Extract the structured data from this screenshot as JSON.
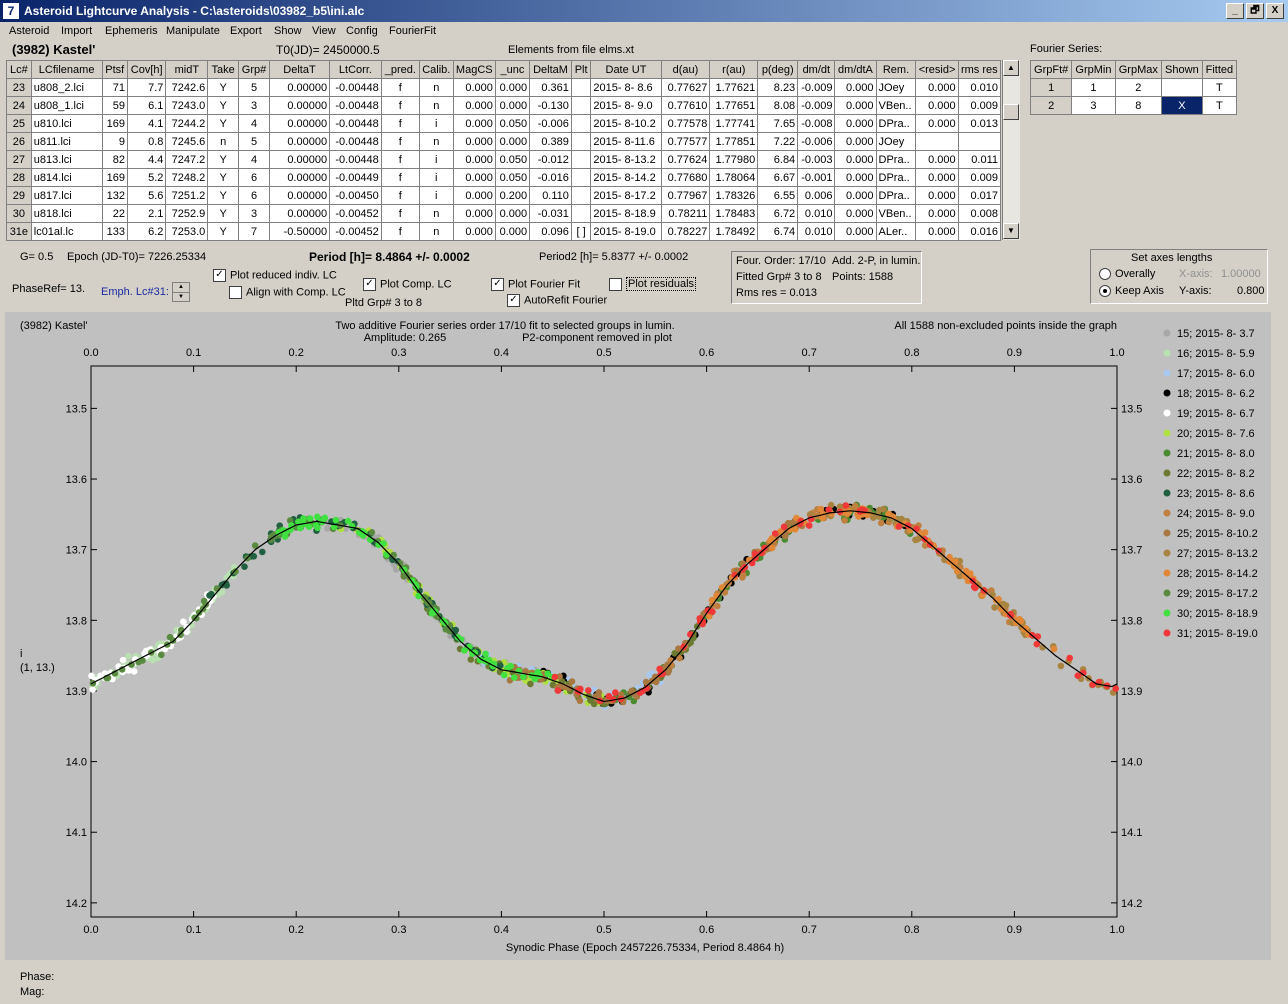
{
  "window": {
    "title": "Asteroid Lightcurve Analysis - C:\\asteroids\\03982_b5\\ini.alc",
    "icon_text": "7"
  },
  "window_buttons": [
    "_",
    "🗗",
    "X"
  ],
  "menu": [
    "Asteroid",
    "Import",
    "Ephemeris",
    "Manipulate",
    "Export",
    "Show",
    "View",
    "Config",
    "FourierFit"
  ],
  "header": {
    "object": "(3982) Kastel'",
    "t0": "T0(JD)= 2450000.5",
    "elements": "Elements from file elms.xt",
    "fourier_series_label": "Fourier Series:"
  },
  "lc_table": {
    "columns": [
      "Lc#",
      "LCfilename",
      "Ptsf",
      "Cov[h]",
      "midT",
      "Take",
      "Grp#",
      "DeltaT",
      "LtCorr.",
      "_pred.",
      "Calib.",
      "MagCS",
      "_unc",
      "DeltaM",
      "Plt",
      "Date UT",
      "d(au)",
      "r(au)",
      "p(deg)",
      "dm/dt",
      "dm/dtA",
      "Rem.",
      "<resid>",
      "rms res"
    ],
    "rows": [
      [
        "23",
        "u808_2.lci",
        "71",
        "7.7",
        "7242.6",
        "Y",
        "5",
        "0.00000",
        "-0.00448",
        "f",
        "n",
        "0.000",
        "0.000",
        "0.361",
        "",
        "2015- 8- 8.6",
        "0.77627",
        "1.77621",
        "8.23",
        "-0.009",
        "0.000",
        "JOey",
        "0.000",
        "0.010"
      ],
      [
        "24",
        "u808_1.lci",
        "59",
        "6.1",
        "7243.0",
        "Y",
        "3",
        "0.00000",
        "-0.00448",
        "f",
        "n",
        "0.000",
        "0.000",
        "-0.130",
        "",
        "2015- 8- 9.0",
        "0.77610",
        "1.77651",
        "8.08",
        "-0.009",
        "0.000",
        "VBen..",
        "0.000",
        "0.009"
      ],
      [
        "25",
        "u810.lci",
        "169",
        "4.1",
        "7244.2",
        "Y",
        "4",
        "0.00000",
        "-0.00448",
        "f",
        "i",
        "0.000",
        "0.050",
        "-0.006",
        "",
        "2015- 8-10.2",
        "0.77578",
        "1.77741",
        "7.65",
        "-0.008",
        "0.000",
        "DPra..",
        "0.000",
        "0.013"
      ],
      [
        "26",
        "u811.lci",
        "9",
        "0.8",
        "7245.6",
        "n",
        "5",
        "0.00000",
        "-0.00448",
        "f",
        "n",
        "0.000",
        "0.000",
        "0.389",
        "",
        "2015- 8-11.6",
        "0.77577",
        "1.77851",
        "7.22",
        "-0.006",
        "0.000",
        "JOey",
        "",
        ""
      ],
      [
        "27",
        "u813.lci",
        "82",
        "4.4",
        "7247.2",
        "Y",
        "4",
        "0.00000",
        "-0.00448",
        "f",
        "i",
        "0.000",
        "0.050",
        "-0.012",
        "",
        "2015- 8-13.2",
        "0.77624",
        "1.77980",
        "6.84",
        "-0.003",
        "0.000",
        "DPra..",
        "0.000",
        "0.011"
      ],
      [
        "28",
        "u814.lci",
        "169",
        "5.2",
        "7248.2",
        "Y",
        "6",
        "0.00000",
        "-0.00449",
        "f",
        "i",
        "0.000",
        "0.050",
        "-0.016",
        "",
        "2015- 8-14.2",
        "0.77680",
        "1.78064",
        "6.67",
        "-0.001",
        "0.000",
        "DPra..",
        "0.000",
        "0.009"
      ],
      [
        "29",
        "u817.lci",
        "132",
        "5.6",
        "7251.2",
        "Y",
        "6",
        "0.00000",
        "-0.00450",
        "f",
        "i",
        "0.000",
        "0.200",
        "0.110",
        "",
        "2015- 8-17.2",
        "0.77967",
        "1.78326",
        "6.55",
        "0.006",
        "0.000",
        "DPra..",
        "0.000",
        "0.017"
      ],
      [
        "30",
        "u818.lci",
        "22",
        "2.1",
        "7252.9",
        "Y",
        "3",
        "0.00000",
        "-0.00452",
        "f",
        "n",
        "0.000",
        "0.000",
        "-0.031",
        "",
        "2015- 8-18.9",
        "0.78211",
        "1.78483",
        "6.72",
        "0.010",
        "0.000",
        "VBen..",
        "0.000",
        "0.008"
      ],
      [
        "31e",
        "lc01al.lc",
        "133",
        "6.2",
        "7253.0",
        "Y",
        "7",
        "-0.50000",
        "-0.00452",
        "f",
        "n",
        "0.000",
        "0.000",
        "0.096",
        "[ ]",
        "2015- 8-19.0",
        "0.78227",
        "1.78492",
        "6.74",
        "0.010",
        "0.000",
        "ALer..",
        "0.000",
        "0.016"
      ]
    ]
  },
  "fourier_table": {
    "columns": [
      "GrpFt#",
      "GrpMin",
      "GrpMax",
      "Shown",
      "Fitted"
    ],
    "rows": [
      [
        "1",
        "1",
        "2",
        "",
        "T"
      ],
      [
        "2",
        "3",
        "8",
        "X",
        "T"
      ]
    ]
  },
  "controls": {
    "g": "G= 0.5",
    "epoch": "Epoch (JD-T0)= 7226.25334",
    "period": "Period [h]= 8.4864 +/- 0.0002",
    "period2": "Period2 [h]= 5.8377 +/- 0.0002",
    "phaseref": "PhaseRef= 13.",
    "emph": "Emph. Lc#31:",
    "plot_reduced": "Plot reduced indiv. LC",
    "align_comp": "Align with Comp. LC",
    "plot_comp": "Plot Comp. LC",
    "pltd_grp": "Pltd Grp#  3   to   8",
    "plot_fourier": "Plot Fourier Fit",
    "autorefit": "AutoRefit Fourier",
    "plot_residuals": "Plot residuals",
    "checked_mark": "✓",
    "four_order": "Four. Order: 17/10",
    "add_2p": "Add. 2-P, in lumin.",
    "fitted_grp": "Fitted Grp# 3 to 8",
    "points": "Points: 1588",
    "rms_res": "Rms res      = 0.013",
    "axes_title": "Set axes lengths",
    "overally": "Overally",
    "keep_axis": "Keep Axis",
    "xaxis_label": "X-axis:",
    "xaxis_val": "1.00000",
    "yaxis_label": "Y-axis:",
    "yaxis_val": "0.800"
  },
  "status": {
    "phase": "Phase:",
    "mag": "Mag:"
  },
  "chart_data": {
    "type": "scatter",
    "title": "(3982) Kastel'",
    "subtitle": "Two additive Fourier series order 17/10 fit to selected groups in lumin.",
    "amplitude": "Amplitude: 0.265",
    "p2_note": "P2-component removed in plot",
    "points_note": "All 1588 non-excluded points inside the graph",
    "xlabel": "Synodic Phase (Epoch 2457226.75334, Period 8.4864 h)",
    "ylabel": "i",
    "ylabel2": "(1, 13.)",
    "xlim": [
      0.0,
      1.0
    ],
    "ylim": [
      14.22,
      13.44
    ],
    "y_inverted": true,
    "xticks": [
      "0.0",
      "0.1",
      "0.2",
      "0.3",
      "0.4",
      "0.5",
      "0.6",
      "0.7",
      "0.8",
      "0.9",
      "1.0"
    ],
    "yticks": [
      "13.5",
      "13.6",
      "13.7",
      "13.8",
      "13.9",
      "14.0",
      "14.1",
      "14.2"
    ],
    "background": "#c0c0c0",
    "legend_position": "right",
    "fit_curve": {
      "x": [
        0.0,
        0.02,
        0.04,
        0.06,
        0.08,
        0.1,
        0.12,
        0.14,
        0.16,
        0.18,
        0.2,
        0.22,
        0.24,
        0.26,
        0.28,
        0.3,
        0.32,
        0.34,
        0.36,
        0.38,
        0.4,
        0.42,
        0.44,
        0.46,
        0.48,
        0.5,
        0.52,
        0.54,
        0.56,
        0.58,
        0.6,
        0.62,
        0.64,
        0.66,
        0.68,
        0.7,
        0.72,
        0.74,
        0.76,
        0.78,
        0.8,
        0.82,
        0.84,
        0.86,
        0.88,
        0.9,
        0.92,
        0.94,
        0.96,
        0.98,
        1.0
      ],
      "y": [
        13.89,
        13.875,
        13.86,
        13.845,
        13.83,
        13.8,
        13.765,
        13.73,
        13.7,
        13.68,
        13.665,
        13.66,
        13.665,
        13.67,
        13.69,
        13.72,
        13.76,
        13.795,
        13.83,
        13.855,
        13.87,
        13.875,
        13.88,
        13.89,
        13.905,
        13.915,
        13.91,
        13.895,
        13.87,
        13.835,
        13.79,
        13.75,
        13.72,
        13.695,
        13.67,
        13.655,
        13.648,
        13.645,
        13.648,
        13.655,
        13.67,
        13.695,
        13.72,
        13.745,
        13.77,
        13.8,
        13.825,
        13.85,
        13.87,
        13.89,
        13.895
      ]
    },
    "series": [
      {
        "name": "15; 2015- 8- 3.7",
        "color": "#a8a8a8",
        "phase_range": [
          0.22,
          0.46
        ]
      },
      {
        "name": "16; 2015- 8- 5.9",
        "color": "#b8e0b0",
        "phase_range": [
          0.0,
          0.14
        ]
      },
      {
        "name": "17; 2015- 8- 6.0",
        "color": "#a8c8f0",
        "phase_range": [
          0.38,
          0.56
        ]
      },
      {
        "name": "18; 2015- 8- 6.2",
        "color": "#000000",
        "phase_range": [
          0.44,
          0.8
        ]
      },
      {
        "name": "19; 2015- 8- 6.7",
        "color": "#ffffff",
        "phase_range": [
          0.0,
          0.12
        ]
      },
      {
        "name": "20; 2015- 8- 7.6",
        "color": "#b0e040",
        "phase_range": [
          0.24,
          0.5
        ]
      },
      {
        "name": "21; 2015- 8- 8.0",
        "color": "#4a8a30",
        "phase_range": [
          0.5,
          0.8
        ]
      },
      {
        "name": "22; 2015- 8- 8.2",
        "color": "#6a7a30",
        "phase_range": [
          0.3,
          0.6
        ]
      },
      {
        "name": "23; 2015- 8- 8.6",
        "color": "#206040",
        "phase_range": [
          0.1,
          0.4
        ]
      },
      {
        "name": "24; 2015- 8- 9.0",
        "color": "#c08040",
        "phase_range": [
          0.55,
          0.9
        ]
      },
      {
        "name": "25; 2015- 8-10.2",
        "color": "#a87840",
        "phase_range": [
          0.4,
          0.7
        ]
      },
      {
        "name": "27; 2015- 8-13.2",
        "color": "#a88440",
        "phase_range": [
          0.7,
          1.0
        ]
      },
      {
        "name": "28; 2015- 8-14.2",
        "color": "#e08838",
        "phase_range": [
          0.6,
          0.95
        ]
      },
      {
        "name": "29; 2015- 8-17.2",
        "color": "#5a8a40",
        "phase_range": [
          0.0,
          0.35
        ]
      },
      {
        "name": "30; 2015- 8-18.9",
        "color": "#40e040",
        "phase_range": [
          0.18,
          0.45
        ]
      },
      {
        "name": "31; 2015- 8-19.0",
        "color": "#f03838",
        "phase_range": [
          0.45,
          1.0
        ]
      }
    ]
  }
}
